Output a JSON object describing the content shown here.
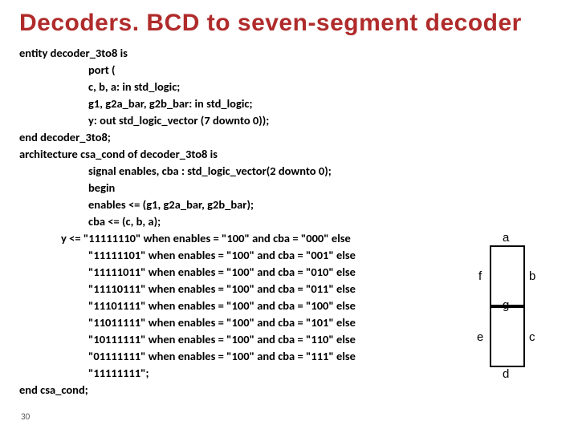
{
  "title": "Decoders. BCD to seven-segment decoder",
  "code": {
    "l01": "entity decoder_3to8 is",
    "l02": "port (",
    "l03": "c, b, a: in std_logic;",
    "l04": "g1, g2a_bar, g2b_bar: in std_logic;",
    "l05": "y: out std_logic_vector (7 downto 0));",
    "l06": "end decoder_3to8;",
    "l07": "architecture csa_cond of decoder_3to8 is",
    "l08": "signal enables, cba : std_logic_vector(2 downto 0);",
    "l09": "begin",
    "l10": "enables <= (g1, g2a_bar, g2b_bar);",
    "l11": "cba <= (c, b, a);",
    "l12": "y <= \"11111110\" when enables = \"100\" and cba = \"000\" else",
    "l13": "\"11111101\" when enables = \"100\" and cba = \"001\" else",
    "l14": "\"11111011\" when enables = \"100\" and cba = \"010\" else",
    "l15": "\"11110111\" when enables = \"100\" and cba = \"011\" else",
    "l16": "\"11101111\" when enables = \"100\" and cba = \"100\" else",
    "l17": "\"11011111\" when enables = \"100\" and cba = \"101\" else",
    "l18": "\"10111111\" when enables = \"100\" and cba = \"110\" else",
    "l19": "\"01111111\" when enables = \"100\" and cba = \"111\" else",
    "l20": "\"11111111\";",
    "l21": "end csa_cond;"
  },
  "slide_number": "30",
  "segments": {
    "a": "a",
    "b": "b",
    "c": "c",
    "d": "d",
    "e": "e",
    "f": "f",
    "g": "g"
  }
}
